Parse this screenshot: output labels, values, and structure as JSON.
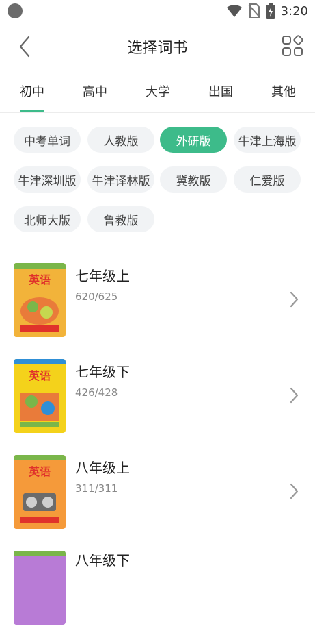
{
  "status_bar": {
    "time": "3:20",
    "icons": [
      "wifi-icon",
      "no-sim-icon",
      "battery-charging-icon"
    ]
  },
  "header": {
    "title": "选择词书",
    "back_icon": "chevron-left-icon",
    "menu_icon": "grid-menu-icon"
  },
  "tabs": [
    {
      "label": "初中",
      "active": true
    },
    {
      "label": "高中",
      "active": false
    },
    {
      "label": "大学",
      "active": false
    },
    {
      "label": "出国",
      "active": false
    },
    {
      "label": "其他",
      "active": false
    }
  ],
  "versions": [
    {
      "label": "中考单词",
      "selected": false
    },
    {
      "label": "人教版",
      "selected": false
    },
    {
      "label": "外研版",
      "selected": true
    },
    {
      "label": "牛津上海版",
      "selected": false
    },
    {
      "label": "牛津深圳版",
      "selected": false
    },
    {
      "label": "牛津译林版",
      "selected": false
    },
    {
      "label": "冀教版",
      "selected": false
    },
    {
      "label": "仁爱版",
      "selected": false
    },
    {
      "label": "北师大版",
      "selected": false
    },
    {
      "label": "鲁教版",
      "selected": false
    }
  ],
  "books": [
    {
      "title": "七年级上",
      "count": "620/625",
      "cover_text": "英语"
    },
    {
      "title": "七年级下",
      "count": "426/428",
      "cover_text": "英语"
    },
    {
      "title": "八年级上",
      "count": "311/311",
      "cover_text": "英语"
    },
    {
      "title": "八年级下",
      "count": "",
      "cover_text": ""
    }
  ],
  "colors": {
    "accent": "#3dbb8a",
    "chip_bg": "#f1f3f5",
    "cover_1": "#f2b33a",
    "cover_2": "#f4d21b",
    "cover_3": "#f59a3a",
    "cover_4": "#b87bd6"
  }
}
